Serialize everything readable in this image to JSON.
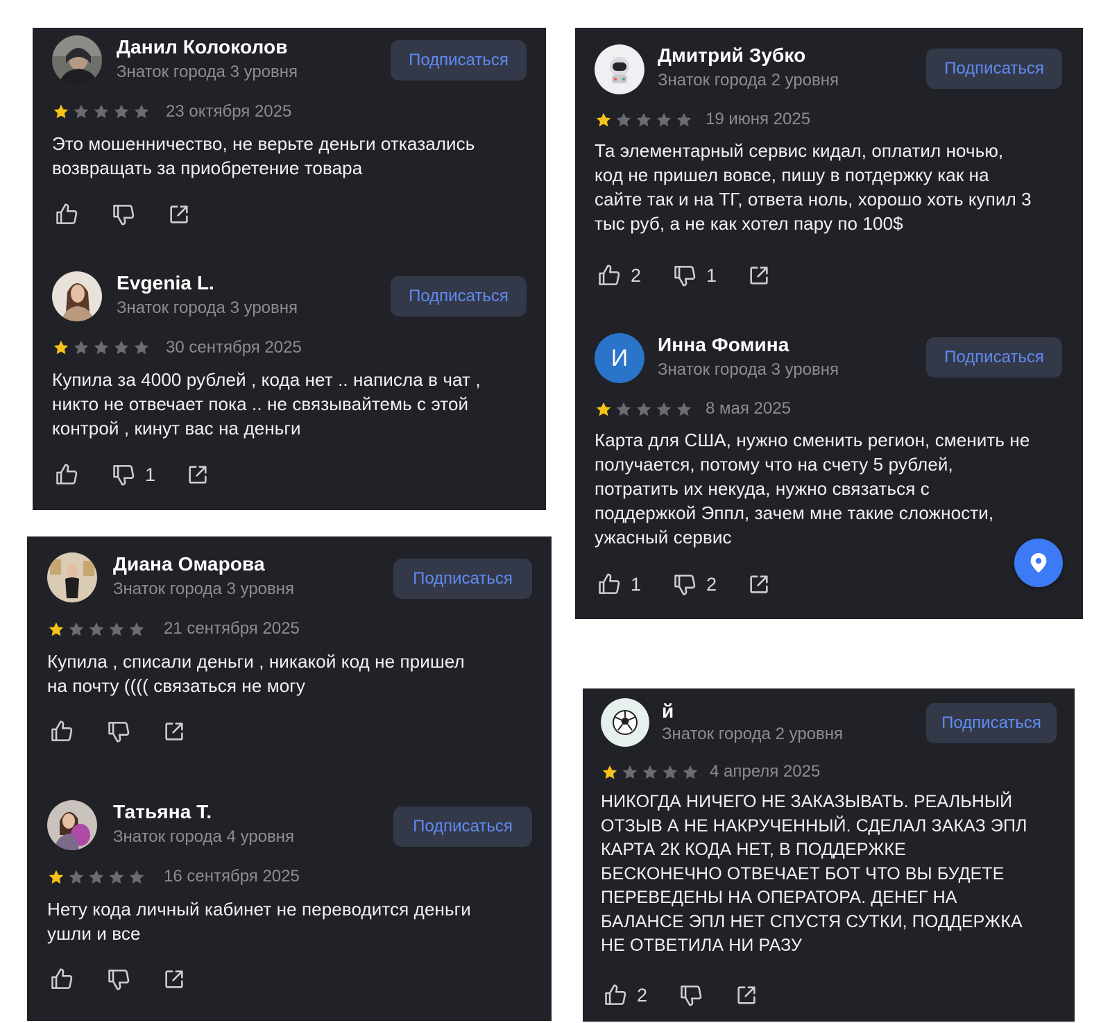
{
  "subscribe_label": "Подписаться",
  "colors": {
    "panel_bg": "#212227",
    "star_active": "#f7c318",
    "star_inactive": "#6b6c72",
    "accent": "#5f8bf1",
    "fab": "#3d7bf6"
  },
  "reviews": [
    {
      "name": "Данил Колоколов",
      "badge": "Знаток города 3 уровня",
      "rating": 1,
      "date": "23 октября 2025",
      "text": [
        "Это мошенничество, не верьте деньги отказались",
        "возвращать за приобретение товара"
      ],
      "likes": "",
      "dislikes": "",
      "avatar": "photo-dark-hoodie"
    },
    {
      "name": "Evgenia L.",
      "badge": "Знаток города 3 уровня",
      "rating": 1,
      "date": "30 сентября 2025",
      "text": [
        "Купила за 4000 рублей , кода нет .. написла в чат ,",
        "никто не отвечает пока .. не связывайтемь с этой",
        "контрой , кинут вас на деньги"
      ],
      "likes": "",
      "dislikes": "1",
      "avatar": "photo-woman"
    },
    {
      "name": "Диана Омарова",
      "badge": "Знаток города 3 уровня",
      "rating": 1,
      "date": "21 сентября 2025",
      "text": [
        "Купила , списали деньги , никакой код не пришел",
        "на почту (((( связаться не могу"
      ],
      "likes": "",
      "dislikes": "",
      "avatar": "photo-woman-room"
    },
    {
      "name": "Татьяна Т.",
      "badge": "Знаток города 4 уровня",
      "rating": 1,
      "date": "16 сентября 2025",
      "text": [
        "Нету кода личный кабинет не переводится деньги",
        "ушли и все"
      ],
      "likes": "",
      "dislikes": "",
      "avatar": "photo-woman-child"
    },
    {
      "name": "Дмитрий Зубко",
      "badge": "Знаток города 2 уровня",
      "rating": 1,
      "date": "19 июня 2025",
      "text": [
        "Та элементарный сервис кидал, оплатил ночью,",
        "код не пришел вовсе, пишу в потдержку как на",
        "сайте так и на ТГ, ответа ноль, хорошо хоть купил 3",
        "тыс руб, а не как хотел пару по 100$"
      ],
      "likes": "2",
      "dislikes": "1",
      "avatar": "astronaut-icon"
    },
    {
      "name": "Инна Фомина",
      "badge": "Знаток города 3 уровня",
      "rating": 1,
      "date": "8 мая 2025",
      "text": [
        "Карта для США, нужно сменить регион, сменить не",
        "получается, потому что на счету 5 рублей,",
        "потратить их некуда, нужно связаться с",
        "поддержкой Эппл, зачем мне такие сложности,",
        "ужасный сервис"
      ],
      "likes": "1",
      "dislikes": "2",
      "avatar": "letter-avatar",
      "initial": "И"
    },
    {
      "name": "й",
      "badge": "Знаток города 2 уровня",
      "rating": 1,
      "date": "4 апреля 2025",
      "text": [
        "НИКОГДА НИЧЕГО НЕ ЗАКАЗЫВАТЬ. РЕАЛЬНЫЙ",
        "ОТЗЫВ А НЕ НАКРУЧЕННЫЙ. СДЕЛАЛ ЗАКАЗ ЭПЛ",
        "КАРТА 2К КОДА НЕТ, В ПОДДЕРЖКЕ",
        "БЕСКОНЕЧНО ОТВЕЧАЕТ БОТ ЧТО ВЫ БУДЕТЕ",
        "ПЕРЕВЕДЕНЫ НА ОПЕРАТОРА. ДЕНЕГ НА",
        "БАЛАНСЕ ЭПЛ НЕТ СПУСТЯ СУТКИ, ПОДДЕРЖКА",
        "НЕ ОТВЕТИЛА НИ РАЗУ"
      ],
      "likes": "2",
      "dislikes": "",
      "avatar": "soccer-ball-icon"
    }
  ]
}
